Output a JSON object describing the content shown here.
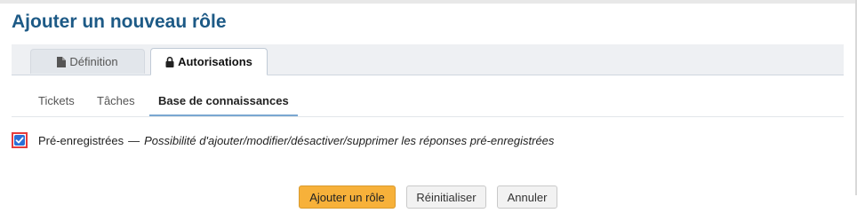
{
  "page": {
    "title": "Ajouter un nouveau rôle"
  },
  "tabs": [
    {
      "label": "Définition",
      "icon": "file-icon",
      "active": false
    },
    {
      "label": "Autorisations",
      "icon": "lock-icon",
      "active": true
    }
  ],
  "subtabs": [
    {
      "label": "Tickets",
      "active": false
    },
    {
      "label": "Tâches",
      "active": false
    },
    {
      "label": "Base de connaissances",
      "active": true
    }
  ],
  "permission": {
    "checked": true,
    "label": "Pré-enregistrées",
    "separator": "—",
    "description": "Possibilité d'ajouter/modifier/désactiver/supprimer les réponses pré-enregistrées"
  },
  "buttons": {
    "primary": "Ajouter un rôle",
    "reset": "Réinitialiser",
    "cancel": "Annuler"
  },
  "colors": {
    "title": "#1d5a86",
    "checkbox": "#2b6fd6",
    "highlight_border": "#e63b3b",
    "primary_button": "#f7b13a"
  }
}
